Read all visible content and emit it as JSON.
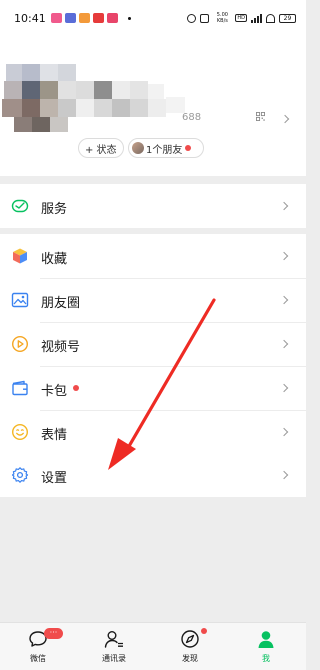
{
  "status_bar": {
    "time": "10:41",
    "net_speed": "5.00 KB/s",
    "battery": "29"
  },
  "profile": {
    "wechat_id_suffix": "688",
    "status_button": "+ 状态",
    "friends_button": "1个朋友"
  },
  "menu": {
    "services": "服务",
    "favorites": "收藏",
    "moments": "朋友圈",
    "channels": "视频号",
    "cards": "卡包",
    "stickers": "表情",
    "settings": "设置"
  },
  "tabs": {
    "chats": "微信",
    "chats_badge": "···",
    "contacts": "通讯录",
    "discover": "发现",
    "me": "我"
  },
  "colors": {
    "accent": "#07c160",
    "badge": "#f04b4b",
    "annotation_arrow": "#ee2b24"
  }
}
